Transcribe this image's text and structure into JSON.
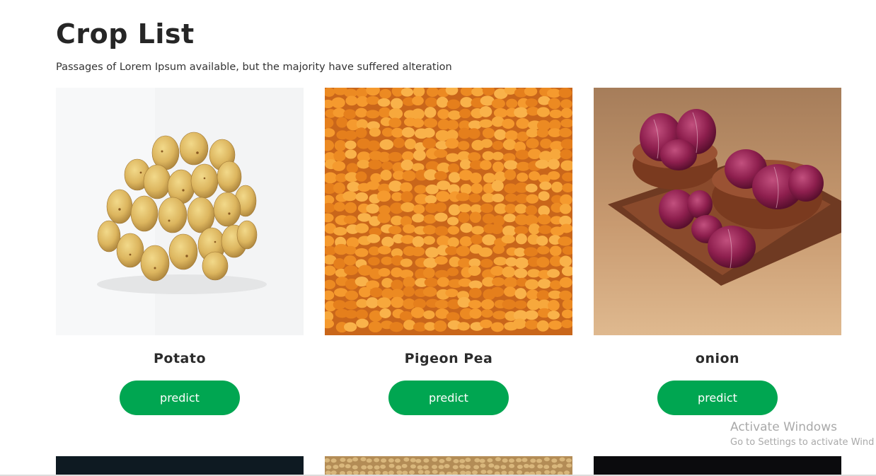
{
  "header": {
    "title": "Crop List",
    "subtitle": "Passages of Lorem Ipsum available, but the majority have suffered alteration"
  },
  "crops": [
    {
      "name": "Potato",
      "button_label": "predict",
      "image": "potato-photo"
    },
    {
      "name": "Pigeon Pea",
      "button_label": "predict",
      "image": "pigeon-pea-photo"
    },
    {
      "name": "onion",
      "button_label": "predict",
      "image": "onion-photo"
    }
  ],
  "watermark": {
    "line1": "Activate Windows",
    "line2": "Go to Settings to activate Wind"
  },
  "colors": {
    "accent": "#00a651",
    "title": "#262626"
  }
}
